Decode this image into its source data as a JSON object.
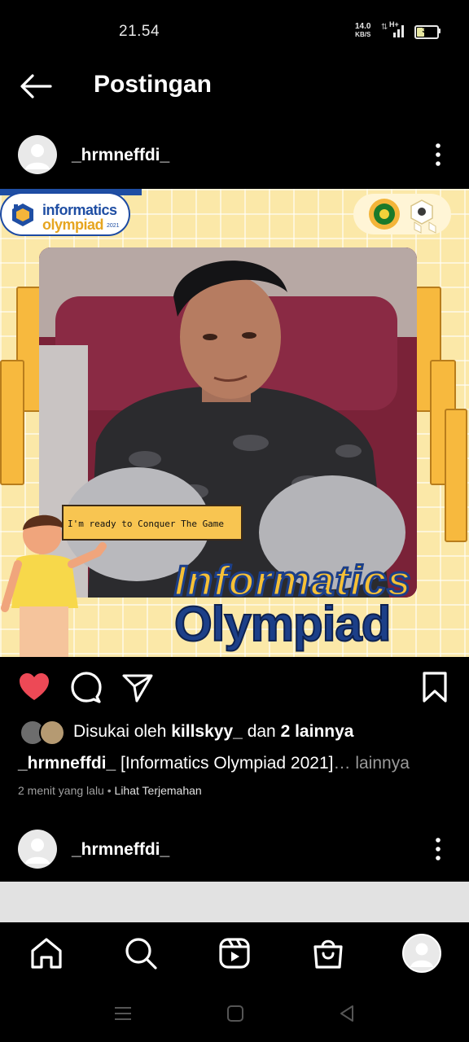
{
  "status_bar": {
    "time": "21.54",
    "net_speed": "14.0",
    "net_unit": "KB/S",
    "network": "H+",
    "battery": "39",
    "battery_level": 0.39
  },
  "header": {
    "title": "Postingan",
    "back_icon": "arrow-left-icon"
  },
  "post": {
    "username": "_hrmneffdi_",
    "image": {
      "logo_line1": "informatics",
      "logo_line2": "olympiad",
      "logo_year": "2021",
      "speech_text": "I'm ready to Conquer The Game",
      "headline1": "Informatics",
      "headline2": "Olympiad"
    },
    "liked": true,
    "likes": {
      "prefix": "Disukai oleh",
      "user": "killskyy_",
      "joiner": "dan",
      "others": "2 lainnya"
    },
    "caption": {
      "username": "_hrmneffdi_",
      "text": "[Informatics Olympiad 2021]",
      "more": "… lainnya"
    },
    "time_ago": "2 menit yang lalu",
    "separator": "•",
    "translate_link": "Lihat Terjemahan"
  },
  "next_post": {
    "username": "_hrmneffdi_"
  },
  "colors": {
    "like_red": "#ed4956",
    "background": "#000000",
    "image_yellow": "#fbe8a8",
    "brand_blue": "#1f4ea3"
  }
}
